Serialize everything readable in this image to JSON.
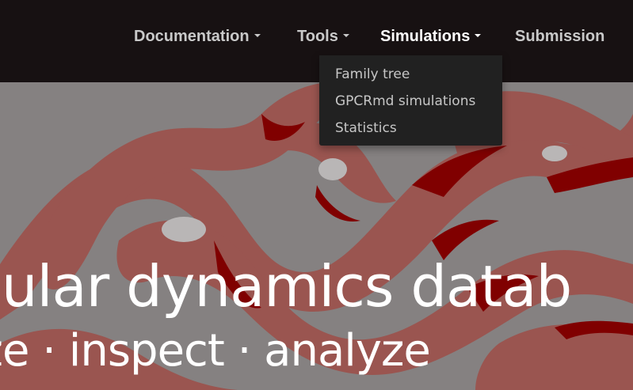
{
  "navbar": {
    "items": [
      {
        "label": "Documentation",
        "has_dropdown": true,
        "active": false
      },
      {
        "label": "Tools",
        "has_dropdown": true,
        "active": false
      },
      {
        "label": "Simulations",
        "has_dropdown": true,
        "active": true
      },
      {
        "label": "Submission",
        "has_dropdown": false,
        "active": false
      }
    ]
  },
  "dropdown": {
    "items": [
      {
        "label": "Family tree"
      },
      {
        "label": "GPCRmd simulations"
      },
      {
        "label": "Statistics"
      }
    ]
  },
  "hero": {
    "title": "ecular dynamics datab",
    "subtitle": "ize · inspect · analyze"
  },
  "colors": {
    "navbar_bg": "#171112",
    "hero_bg": "#858181",
    "ribbon_light": "#9a5550",
    "ribbon_dark": "#800000",
    "dropdown_bg": "#212121"
  }
}
